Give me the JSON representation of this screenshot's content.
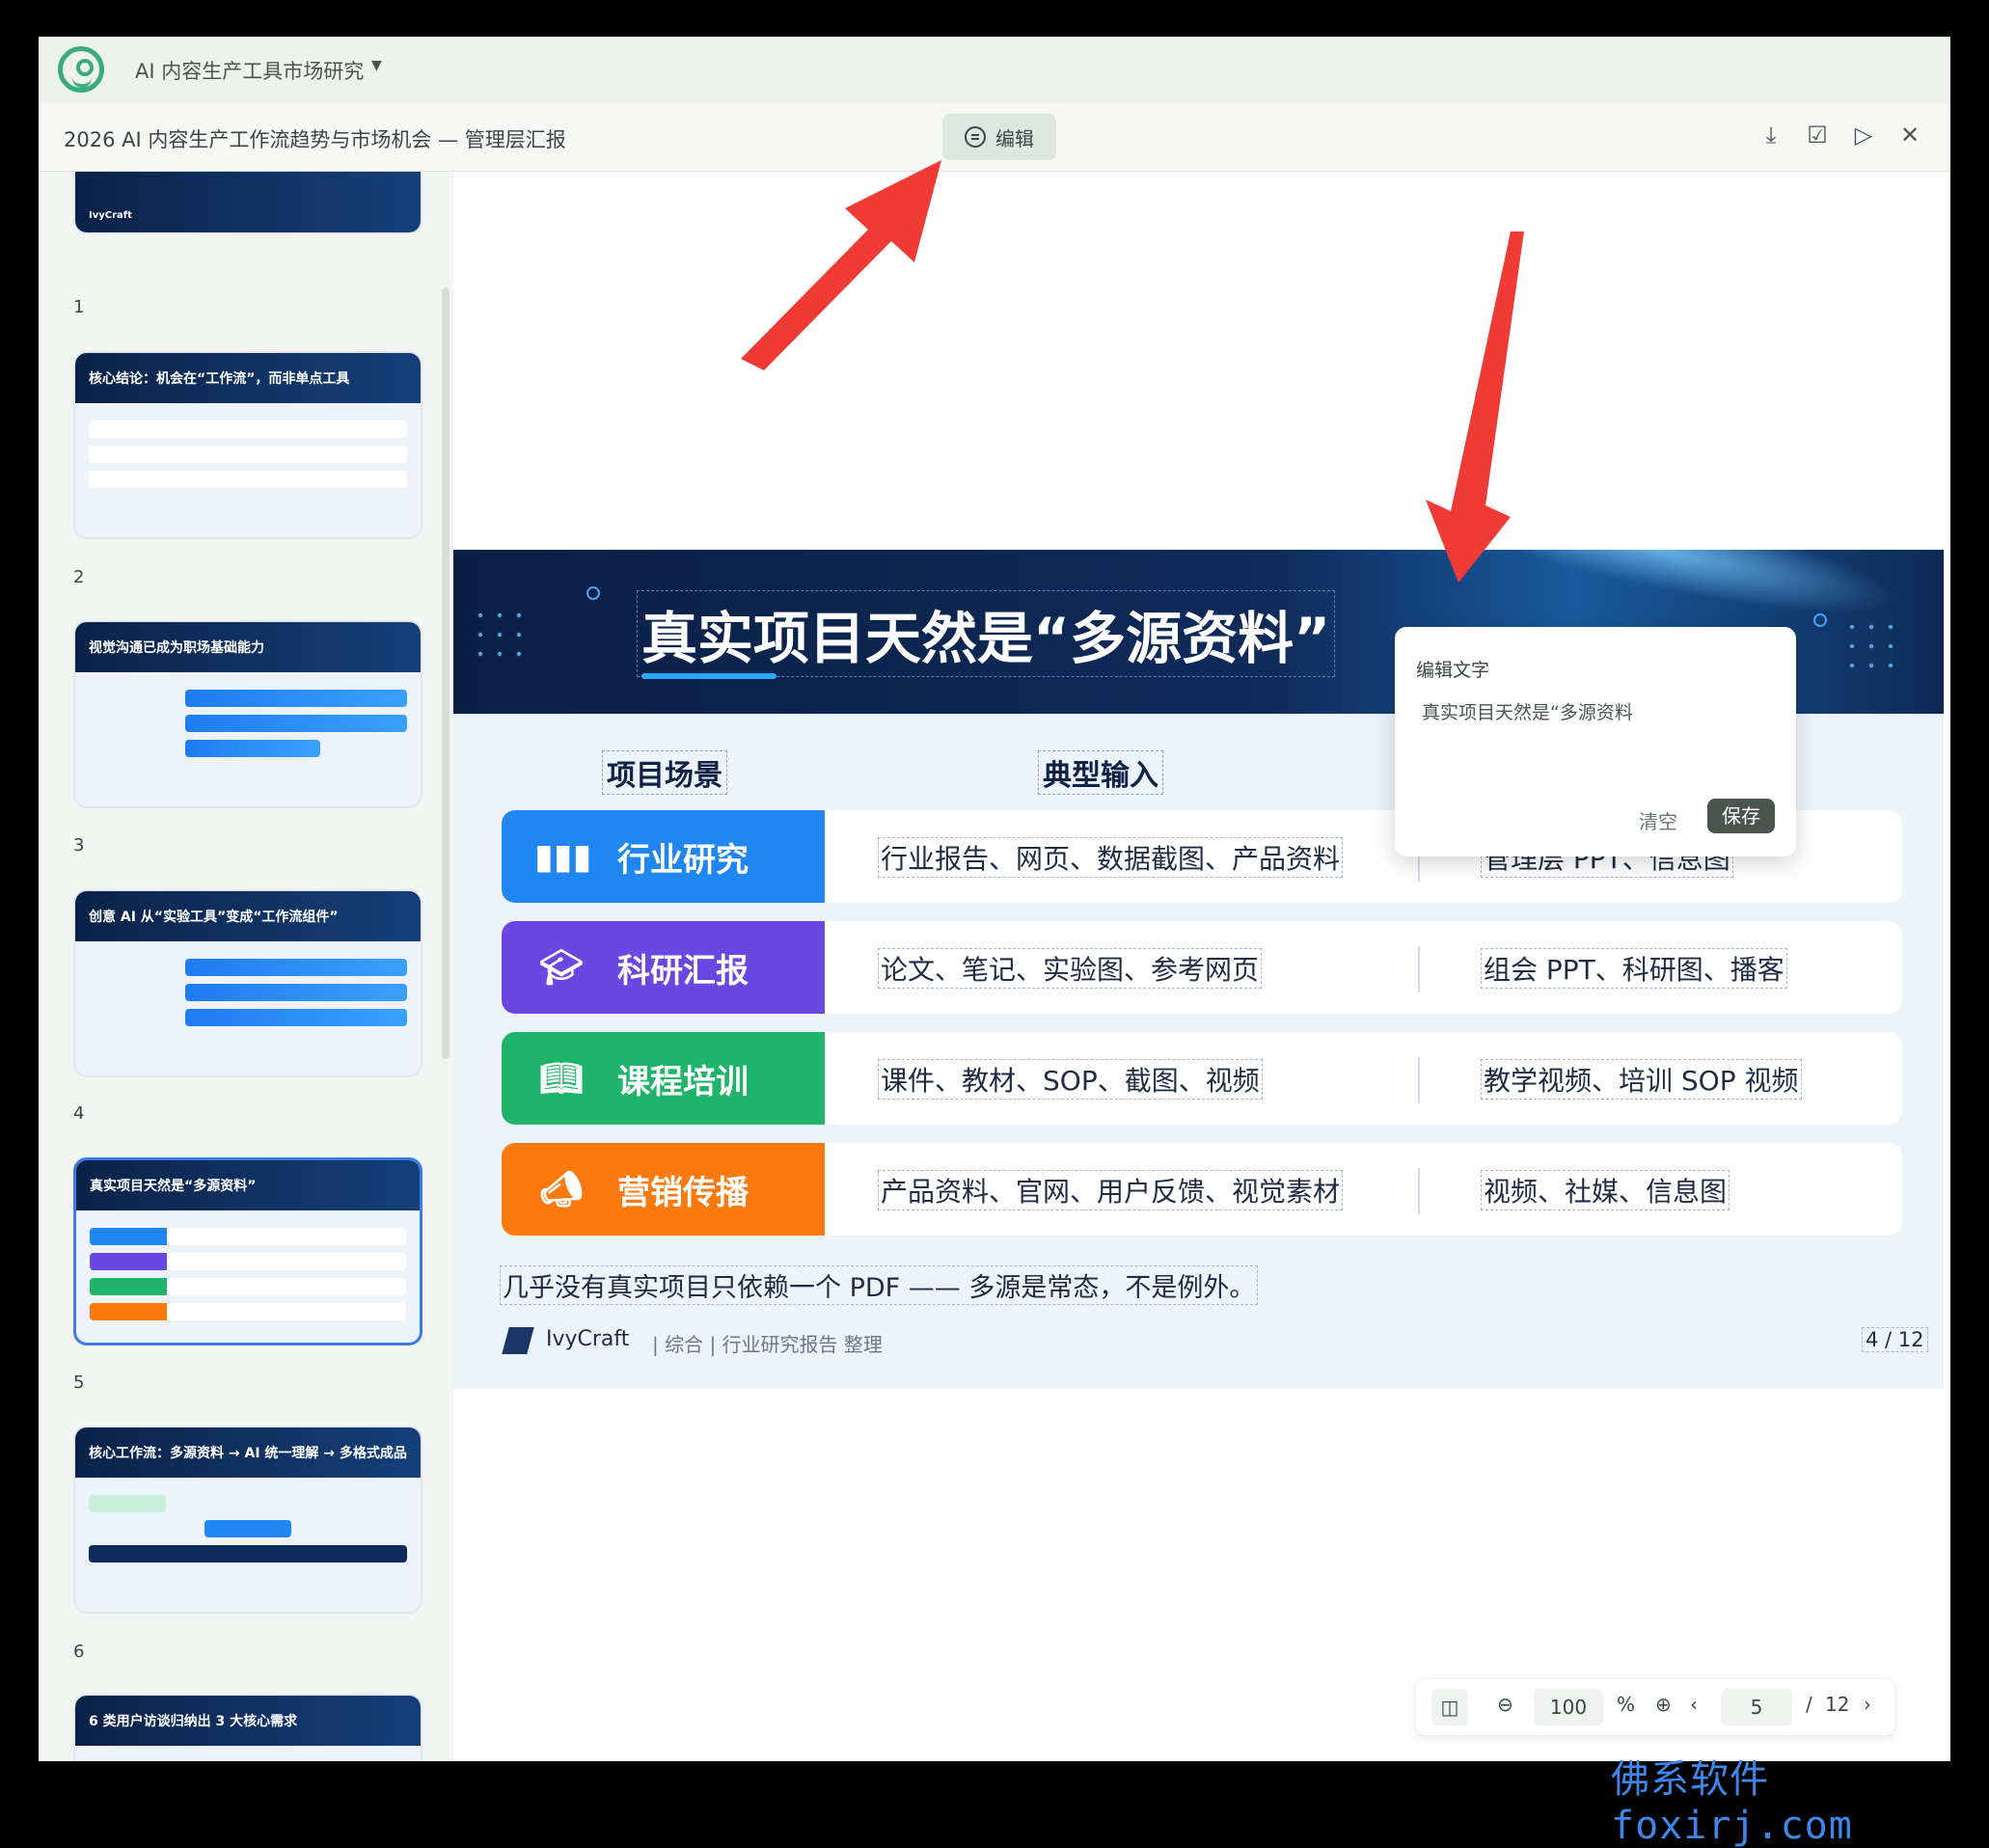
{
  "app": {
    "title": "AI 内容生产工具市场研究"
  },
  "doc": {
    "title": "2026 AI 内容生产工作流趋势与市场机会 — 管理层汇报",
    "edit_label": "编辑"
  },
  "toolbar_icons": [
    "download-icon",
    "check-square-icon",
    "play-icon",
    "close-icon"
  ],
  "sidebar": {
    "thumbs": [
      {
        "num": "1",
        "title": "IvyCraft"
      },
      {
        "num": "2",
        "title": "核心结论：机会在“工作流”，而非单点工具"
      },
      {
        "num": "3",
        "title": "视觉沟通已成为职场基础能力"
      },
      {
        "num": "4",
        "title": "创意 AI 从“实验工具”变成“工作流组件”"
      },
      {
        "num": "5",
        "title": "真实项目天然是“多源资料”"
      },
      {
        "num": "6",
        "title": "核心工作流：多源资料 → AI 统一理解 → 多格式成品"
      },
      {
        "num": "",
        "title": "6 类用户访谈归纳出 3 大核心需求"
      }
    ]
  },
  "slide": {
    "title": "真实项目天然是“多源资料”",
    "col_scene": "项目场景",
    "col_input": "典型输入",
    "rows": [
      {
        "tag": "行业研究",
        "icon": "bar-chart-icon",
        "color": "#1f86f2",
        "input": "行业报告、网页、数据截图、产品资料",
        "output": "管理层 PPT、信息图"
      },
      {
        "tag": "科研汇报",
        "icon": "graduation-cap-icon",
        "color": "#6a47e0",
        "input": "论文、笔记、实验图、参考网页",
        "output": "组会 PPT、科研图、播客"
      },
      {
        "tag": "课程培训",
        "icon": "book-icon",
        "color": "#1fb46a",
        "input": "课件、教材、SOP、截图、视频",
        "output": "教学视频、培训 SOP 视频"
      },
      {
        "tag": "营销传播",
        "icon": "megaphone-icon",
        "color": "#fb7a10",
        "input": "产品资料、官网、用户反馈、视觉素材",
        "output": "视频、社媒、信息图"
      }
    ],
    "note": "几乎没有真实项目只依赖一个 PDF —— 多源是常态，不是例外。",
    "footer_brand": "IvyCraft",
    "footer_src": "|   综合 | 行业研究报告 整理",
    "footer_page": "4 / 12"
  },
  "popup": {
    "title": "编辑文字",
    "text": "真实项目天然是“多源资料",
    "clear": "清空",
    "save": "保存"
  },
  "zoombar": {
    "zoom": "100",
    "pct": "%",
    "page": "5",
    "sep": "/",
    "total": "12"
  },
  "watermark": "佛系软件foxirj.com",
  "colors": {
    "accent": "#3cab7b",
    "arrow": "#f03a35",
    "slide_dark": "#0b1f44"
  }
}
